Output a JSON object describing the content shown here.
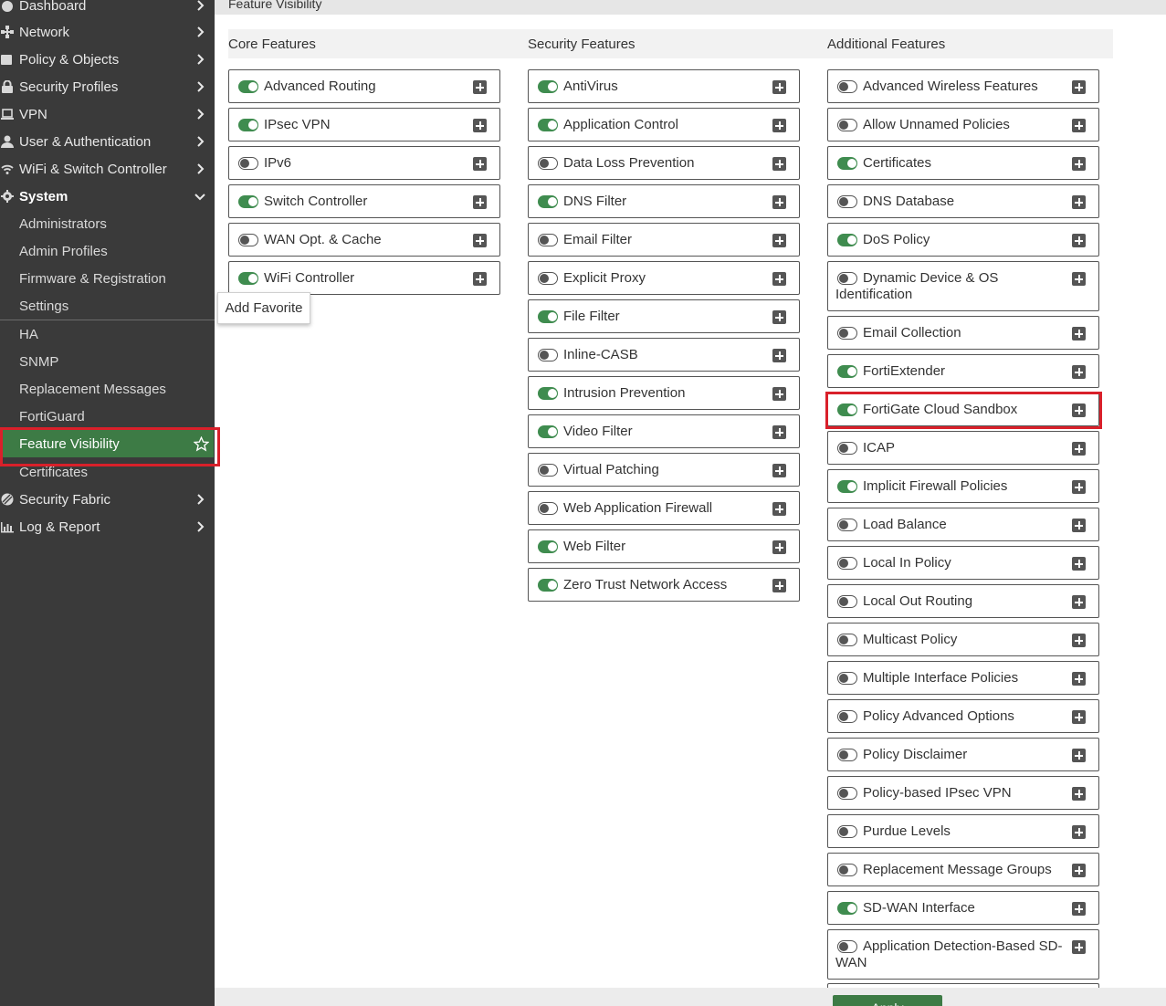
{
  "sidebar": {
    "items": [
      {
        "label": "Dashboard",
        "icon": "dashboard-icon",
        "chevron": "right"
      },
      {
        "label": "Network",
        "icon": "network-icon",
        "chevron": "right"
      },
      {
        "label": "Policy & Objects",
        "icon": "policy-icon",
        "chevron": "right"
      },
      {
        "label": "Security Profiles",
        "icon": "lock-icon",
        "chevron": "right"
      },
      {
        "label": "VPN",
        "icon": "laptop-icon",
        "chevron": "right"
      },
      {
        "label": "User & Authentication",
        "icon": "user-icon",
        "chevron": "right"
      },
      {
        "label": "WiFi & Switch Controller",
        "icon": "wifi-icon",
        "chevron": "right"
      },
      {
        "label": "System",
        "icon": "gear-icon",
        "chevron": "down"
      }
    ],
    "system_subitems": [
      "Administrators",
      "Admin Profiles",
      "Firmware & Registration",
      "Settings",
      "HA",
      "SNMP",
      "Replacement Messages",
      "FortiGuard",
      "Feature Visibility",
      "Certificates"
    ],
    "active_item": "Feature Visibility",
    "bottom_items": [
      {
        "label": "Security Fabric",
        "icon": "fabric-icon",
        "chevron": "right"
      },
      {
        "label": "Log & Report",
        "icon": "chart-icon",
        "chevron": "right"
      }
    ]
  },
  "header": {
    "title": "Feature Visibility"
  },
  "tooltip": {
    "text": "Add Favorite"
  },
  "columns": {
    "core": {
      "title": "Core Features",
      "features": [
        {
          "label": "Advanced Routing",
          "enabled": true
        },
        {
          "label": "IPsec VPN",
          "enabled": true
        },
        {
          "label": "IPv6",
          "enabled": false
        },
        {
          "label": "Switch Controller",
          "enabled": true
        },
        {
          "label": "WAN Opt. & Cache",
          "enabled": false
        },
        {
          "label": "WiFi Controller",
          "enabled": true
        }
      ]
    },
    "security": {
      "title": "Security Features",
      "features": [
        {
          "label": "AntiVirus",
          "enabled": true
        },
        {
          "label": "Application Control",
          "enabled": true
        },
        {
          "label": "Data Loss Prevention",
          "enabled": false
        },
        {
          "label": "DNS Filter",
          "enabled": true
        },
        {
          "label": "Email Filter",
          "enabled": false
        },
        {
          "label": "Explicit Proxy",
          "enabled": false
        },
        {
          "label": "File Filter",
          "enabled": true
        },
        {
          "label": "Inline-CASB",
          "enabled": false
        },
        {
          "label": "Intrusion Prevention",
          "enabled": true
        },
        {
          "label": "Video Filter",
          "enabled": true
        },
        {
          "label": "Virtual Patching",
          "enabled": false
        },
        {
          "label": "Web Application Firewall",
          "enabled": false
        },
        {
          "label": "Web Filter",
          "enabled": true
        },
        {
          "label": "Zero Trust Network Access",
          "enabled": true
        }
      ]
    },
    "additional": {
      "title": "Additional Features",
      "features": [
        {
          "label": "Advanced Wireless Features",
          "enabled": false
        },
        {
          "label": "Allow Unnamed Policies",
          "enabled": false
        },
        {
          "label": "Certificates",
          "enabled": true
        },
        {
          "label": "DNS Database",
          "enabled": false
        },
        {
          "label": "DoS Policy",
          "enabled": true
        },
        {
          "label": "Dynamic Device & OS Identification",
          "enabled": false
        },
        {
          "label": "Email Collection",
          "enabled": false
        },
        {
          "label": "FortiExtender",
          "enabled": true
        },
        {
          "label": "FortiGate Cloud Sandbox",
          "enabled": true
        },
        {
          "label": "ICAP",
          "enabled": false
        },
        {
          "label": "Implicit Firewall Policies",
          "enabled": true
        },
        {
          "label": "Load Balance",
          "enabled": false
        },
        {
          "label": "Local In Policy",
          "enabled": false
        },
        {
          "label": "Local Out Routing",
          "enabled": false
        },
        {
          "label": "Multicast Policy",
          "enabled": false
        },
        {
          "label": "Multiple Interface Policies",
          "enabled": false
        },
        {
          "label": "Policy Advanced Options",
          "enabled": false
        },
        {
          "label": "Policy Disclaimer",
          "enabled": false
        },
        {
          "label": "Policy-based IPsec VPN",
          "enabled": false
        },
        {
          "label": "Purdue Levels",
          "enabled": false
        },
        {
          "label": "Replacement Message Groups",
          "enabled": false
        },
        {
          "label": "SD-WAN Interface",
          "enabled": true
        },
        {
          "label": "Application Detection-Based SD-WAN",
          "enabled": false
        }
      ]
    }
  },
  "footer": {
    "apply_label": "Apply"
  },
  "colors": {
    "sidebar_bg": "#3a3a3a",
    "accent_green": "#3d7b45",
    "highlight_red": "#d9202a"
  }
}
